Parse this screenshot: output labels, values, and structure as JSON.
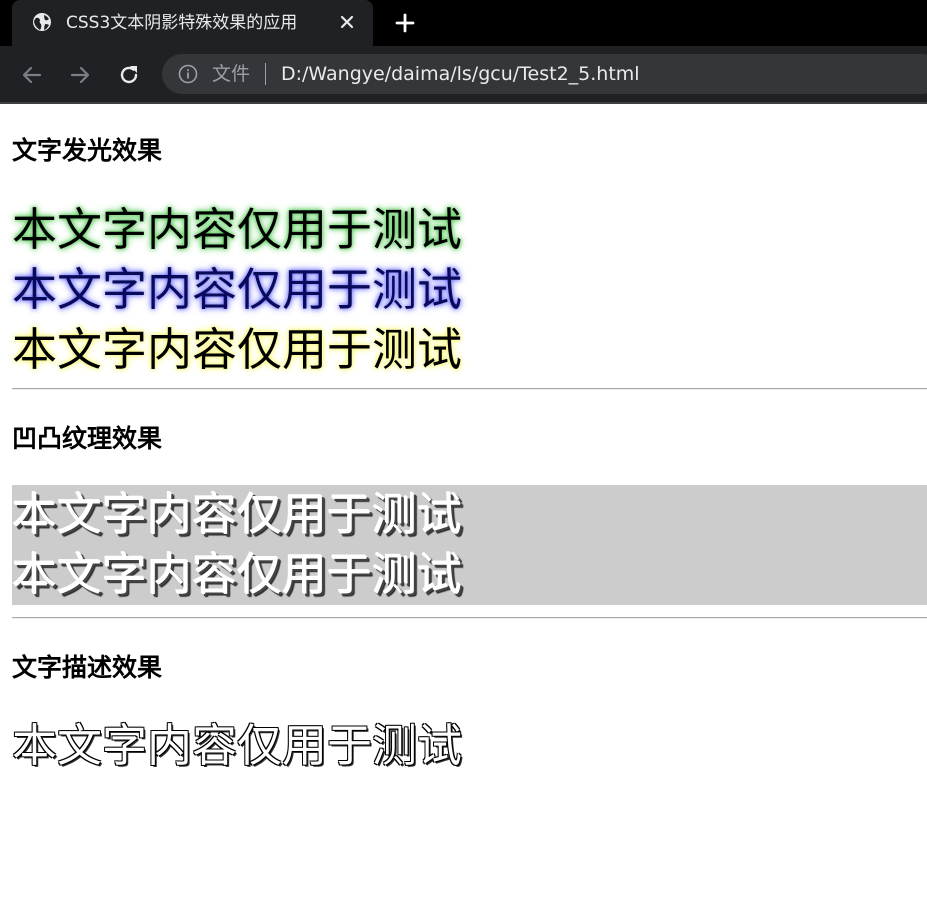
{
  "browser": {
    "tab_title": "CSS3文本阴影特殊效果的应用",
    "scheme_label": "文件",
    "url": "D:/Wangye/daima/ls/gcu/Test2_5.html",
    "icons": [
      "globe-icon",
      "close-icon",
      "plus-icon",
      "back-icon",
      "forward-icon",
      "reload-icon",
      "info-icon"
    ]
  },
  "sections": {
    "glow": {
      "heading": "文字发光效果",
      "lines": [
        "本文字内容仅用于测试",
        "本文字内容仅用于测试",
        "本文字内容仅用于测试"
      ],
      "colors": [
        "#60d060",
        "#8080ff",
        "#ffff80"
      ]
    },
    "emboss": {
      "heading": "凹凸纹理效果",
      "lines": [
        "本文字内容仅用于测试",
        "本文字内容仅用于测试"
      ],
      "background": "#cccccc"
    },
    "outline": {
      "heading": "文字描述效果",
      "lines": [
        "本文字内容仅用于测试"
      ]
    }
  }
}
